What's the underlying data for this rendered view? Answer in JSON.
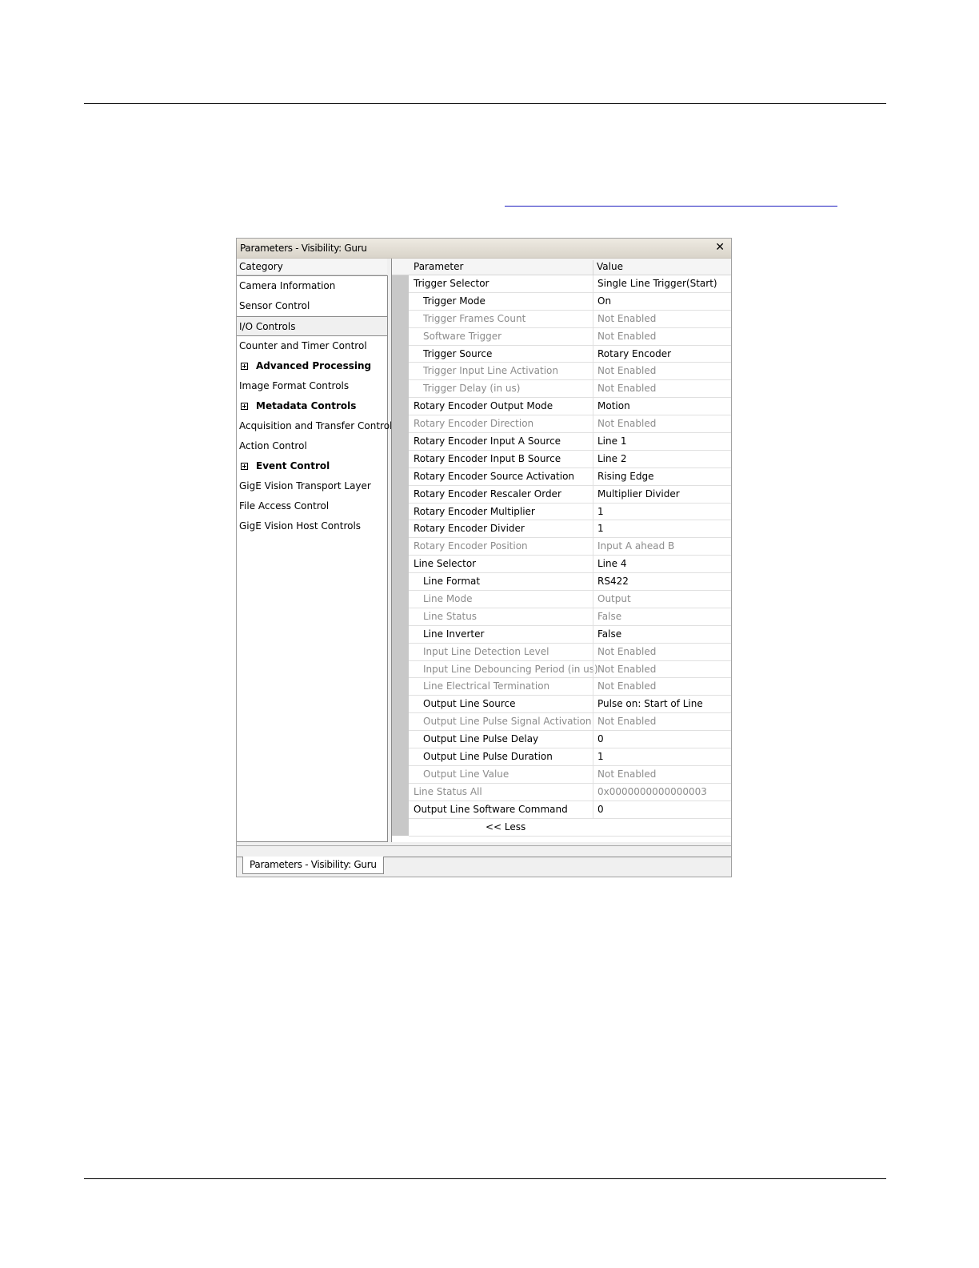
{
  "window": {
    "title": "Parameters - Visibility: Guru",
    "close_glyph": "✕",
    "tab_label": "Parameters - Visibility: Guru"
  },
  "category": {
    "header": "Category",
    "items": [
      {
        "label": "Camera Information",
        "group": false
      },
      {
        "label": "Sensor Control",
        "group": false
      },
      {
        "label": "I/O Controls",
        "group": false,
        "selected": true
      },
      {
        "label": "Counter and Timer Control",
        "group": false
      },
      {
        "label": "Advanced Processing",
        "group": true
      },
      {
        "label": "Image Format Controls",
        "group": false
      },
      {
        "label": "Metadata Controls",
        "group": true
      },
      {
        "label": "Acquisition and Transfer Control",
        "group": false
      },
      {
        "label": "Action Control",
        "group": false
      },
      {
        "label": "Event Control",
        "group": true
      },
      {
        "label": "GigE Vision Transport Layer",
        "group": false
      },
      {
        "label": "File Access Control",
        "group": false
      },
      {
        "label": "GigE Vision Host Controls",
        "group": false
      }
    ]
  },
  "params": {
    "header_parameter": "Parameter",
    "header_value": "Value",
    "less_label": "<< Less",
    "rows": [
      {
        "name": "Trigger Selector",
        "value": "Single Line Trigger(Start)",
        "indent": false,
        "enabled": true
      },
      {
        "name": "Trigger Mode",
        "value": "On",
        "indent": true,
        "enabled": true
      },
      {
        "name": "Trigger Frames Count",
        "value": "Not Enabled",
        "indent": true,
        "enabled": false
      },
      {
        "name": "Software Trigger",
        "value": "Not Enabled",
        "indent": true,
        "enabled": false
      },
      {
        "name": "Trigger Source",
        "value": "Rotary Encoder",
        "indent": true,
        "enabled": true
      },
      {
        "name": "Trigger Input Line Activation",
        "value": "Not Enabled",
        "indent": true,
        "enabled": false
      },
      {
        "name": "Trigger Delay (in us)",
        "value": "Not Enabled",
        "indent": true,
        "enabled": false
      },
      {
        "name": "Rotary Encoder Output Mode",
        "value": "Motion",
        "indent": false,
        "enabled": true
      },
      {
        "name": "Rotary Encoder Direction",
        "value": "Not Enabled",
        "indent": false,
        "enabled": false
      },
      {
        "name": "Rotary Encoder Input A Source",
        "value": "Line 1",
        "indent": false,
        "enabled": true
      },
      {
        "name": "Rotary Encoder Input B Source",
        "value": "Line 2",
        "indent": false,
        "enabled": true
      },
      {
        "name": "Rotary Encoder Source Activation",
        "value": "Rising Edge",
        "indent": false,
        "enabled": true
      },
      {
        "name": "Rotary Encoder Rescaler Order",
        "value": "Multiplier Divider",
        "indent": false,
        "enabled": true
      },
      {
        "name": "Rotary Encoder Multiplier",
        "value": "1",
        "indent": false,
        "enabled": true
      },
      {
        "name": "Rotary Encoder Divider",
        "value": "1",
        "indent": false,
        "enabled": true
      },
      {
        "name": "Rotary Encoder Position",
        "value": "Input A ahead B",
        "indent": false,
        "enabled": false
      },
      {
        "name": "Line Selector",
        "value": "Line 4",
        "indent": false,
        "enabled": true
      },
      {
        "name": "Line Format",
        "value": "RS422",
        "indent": true,
        "enabled": true
      },
      {
        "name": "Line Mode",
        "value": "Output",
        "indent": true,
        "enabled": false
      },
      {
        "name": "Line Status",
        "value": "False",
        "indent": true,
        "enabled": false
      },
      {
        "name": "Line Inverter",
        "value": "False",
        "indent": true,
        "enabled": true
      },
      {
        "name": "Input Line Detection Level",
        "value": "Not Enabled",
        "indent": true,
        "enabled": false
      },
      {
        "name": "Input Line Debouncing Period (in us)",
        "value": "Not Enabled",
        "indent": true,
        "enabled": false
      },
      {
        "name": "Line Electrical Termination",
        "value": "Not Enabled",
        "indent": true,
        "enabled": false
      },
      {
        "name": "Output Line Source",
        "value": "Pulse on: Start of Line",
        "indent": true,
        "enabled": true
      },
      {
        "name": "Output Line Pulse Signal Activation",
        "value": "Not Enabled",
        "indent": true,
        "enabled": false
      },
      {
        "name": "Output Line Pulse Delay",
        "value": "0",
        "indent": true,
        "enabled": true
      },
      {
        "name": "Output Line Pulse Duration",
        "value": "1",
        "indent": true,
        "enabled": true
      },
      {
        "name": "Output Line Value",
        "value": "Not Enabled",
        "indent": true,
        "enabled": false
      },
      {
        "name": "Line Status All",
        "value": "0x0000000000000003",
        "indent": false,
        "enabled": false
      },
      {
        "name": "Output Line Software Command",
        "value": "0",
        "indent": false,
        "enabled": true
      }
    ]
  }
}
